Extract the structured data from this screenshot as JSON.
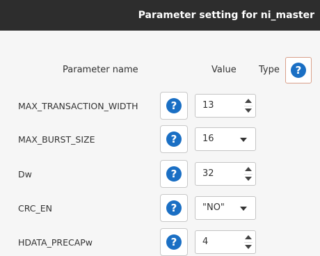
{
  "window": {
    "title": "Parameter setting for ni_master"
  },
  "columns": {
    "name": "Parameter name",
    "value": "Value",
    "type": "Type"
  },
  "help_glyph": "?",
  "colors": {
    "help_icon": "#1a6fc4",
    "titlebar": "#2d2d2d"
  },
  "params": [
    {
      "name": "MAX_TRANSACTION_WIDTH",
      "value": "13",
      "widget": "spinbox"
    },
    {
      "name": "MAX_BURST_SIZE",
      "value": "16",
      "widget": "combobox"
    },
    {
      "name": "Dw",
      "value": "32",
      "widget": "spinbox"
    },
    {
      "name": "CRC_EN",
      "value": "\"NO\"",
      "widget": "combobox"
    },
    {
      "name": "HDATA_PRECAPw",
      "value": "4",
      "widget": "spinbox"
    }
  ]
}
